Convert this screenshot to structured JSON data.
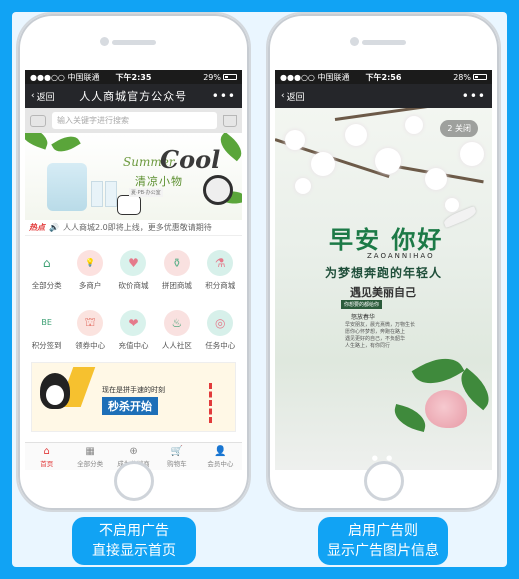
{
  "colors": {
    "background": "#11a3f4",
    "accent": "#e23b3b",
    "nav_dark": "#25262a"
  },
  "left_phone": {
    "status": {
      "carrier": "●●●○○ 中国联通 ",
      "time": "下午2:35",
      "battery": "29%"
    },
    "nav": {
      "back_label": "返回",
      "title": "人人商城官方公众号",
      "more": "•••"
    },
    "search": {
      "placeholder": "输入关键字进行搜索"
    },
    "banner": {
      "summer": "Summer",
      "cool": "Cool",
      "cn": "清凉小物",
      "sub": "夏·PB·办公室"
    },
    "hotline": {
      "tag": "热点",
      "text": "人人商城2.0即将上线，更多优惠敬请期待"
    },
    "grid_items": [
      {
        "label": "全部分类",
        "icon": "home-icon",
        "glyph": "⌂",
        "bg": "#ffffff",
        "fg": "#3b9f72"
      },
      {
        "label": "多商户",
        "icon": "bulb-icon",
        "glyph": "💡",
        "bg": "#fce1df",
        "fg": "#e57a6f"
      },
      {
        "label": "砍价商城",
        "icon": "heart-icon",
        "glyph": "♥",
        "bg": "#d9f2ec",
        "fg": "#e57a8b"
      },
      {
        "label": "拼团商城",
        "icon": "vase-icon",
        "glyph": "⚱",
        "bg": "#f9e1e0",
        "fg": "#5fb18b"
      },
      {
        "label": "积分商城",
        "icon": "bottle-icon",
        "glyph": "⚗",
        "bg": "#d7f0ea",
        "fg": "#e57a8b"
      },
      {
        "label": "积分签到",
        "icon": "be-mine-sign-icon",
        "glyph": "BE",
        "bg": "#ffffff",
        "fg": "#3b9f72"
      },
      {
        "label": "领券中心",
        "icon": "perfume-icon",
        "glyph": "⛫",
        "bg": "#fbe3df",
        "fg": "#e57a6f"
      },
      {
        "label": "充值中心",
        "icon": "heart-wheel-icon",
        "glyph": "❤",
        "bg": "#d9f2ec",
        "fg": "#e57a8b"
      },
      {
        "label": "人人社区",
        "icon": "cake-icon",
        "glyph": "♨",
        "bg": "#f9e1e0",
        "fg": "#3b9f72"
      },
      {
        "label": "任务中心",
        "icon": "circles-icon",
        "glyph": "◎",
        "bg": "#d7f0ea",
        "fg": "#e57a8b"
      }
    ],
    "ad": {
      "line1": "现在是拼手速的时刻",
      "line2": "秒杀开始"
    },
    "tabs": [
      {
        "label": "首页",
        "icon": "home-icon",
        "glyph": "⌂"
      },
      {
        "label": "全部分类",
        "icon": "category-icon",
        "glyph": "▦"
      },
      {
        "label": "成为分销商",
        "icon": "distributor-icon",
        "glyph": "⊕"
      },
      {
        "label": "购物车",
        "icon": "cart-icon",
        "glyph": "🛒"
      },
      {
        "label": "会员中心",
        "icon": "user-icon",
        "glyph": "👤"
      }
    ]
  },
  "right_phone": {
    "status": {
      "carrier": "●●●○○ 中国联通 ",
      "time": "下午2:56",
      "battery": "28%"
    },
    "nav": {
      "back_label": "返回",
      "more": "•••"
    },
    "ad": {
      "close_label": "2 关闭",
      "greeting": "早安 你好",
      "pinyin": "ZAOANNIHAO",
      "slogan": "为梦想奔跑的年轻人",
      "dream": "遇见美丽自己",
      "chip": "你想要的都给你",
      "small": "怒放春华",
      "poem": "早安朋友，晨光熹微，万物生长\n愿你心怀梦想，奔跑在路上\n遇见更好的自己，不负韶华\n人生路上，有你同行"
    }
  },
  "captions": {
    "left": [
      "不启用广告",
      "直接显示首页"
    ],
    "right": [
      "启用广告则",
      "显示广告图片信息"
    ]
  }
}
